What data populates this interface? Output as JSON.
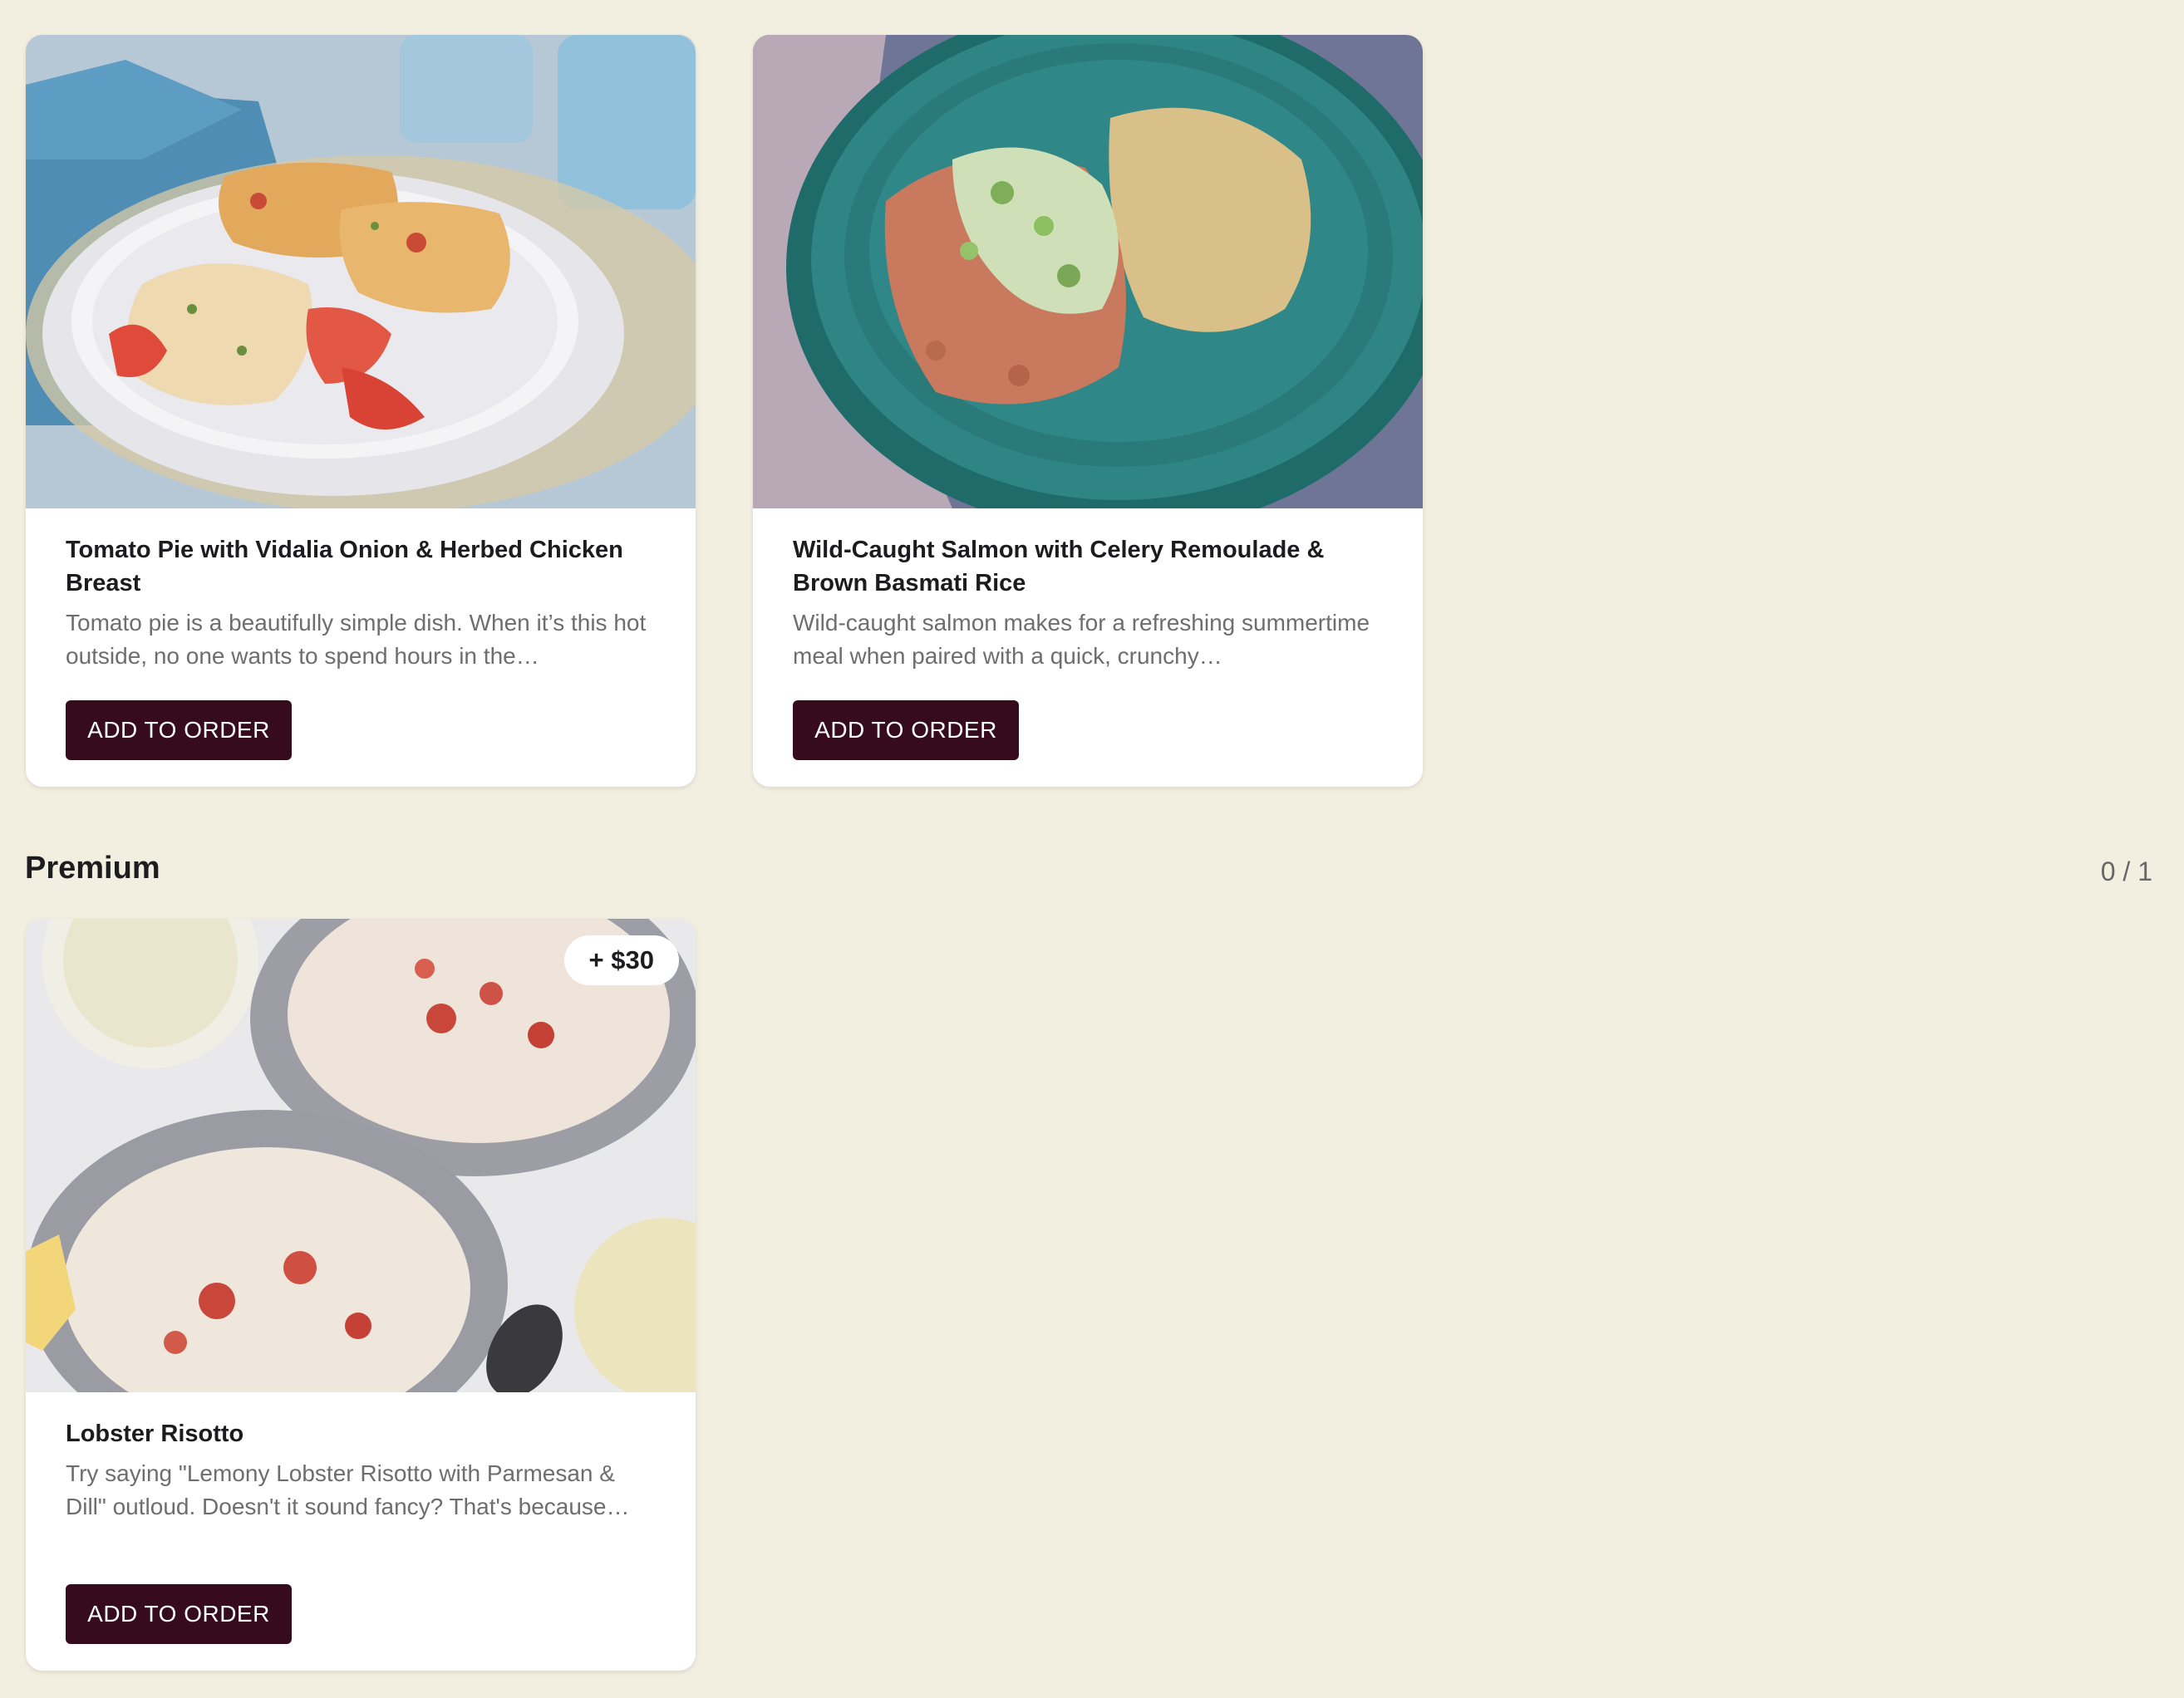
{
  "theme": {
    "background": "#f2efe0",
    "button_color": "#360c1c",
    "card_background": "#ffffff"
  },
  "meals": [
    {
      "title": "Tomato Pie with Vidalia Onion & Herbed Chicken Breast",
      "description": "Tomato pie is a beautifully simple dish. When it’s this hot outside, no one wants to spend hours in the…",
      "button_label": "ADD TO ORDER",
      "image": "tomato-pie-chicken-photo"
    },
    {
      "title": "Wild-Caught Salmon with Celery Remoulade & Brown Basmati Rice",
      "description": "Wild-caught salmon makes for a refreshing summertime meal when paired with a quick, crunchy…",
      "button_label": "ADD TO ORDER",
      "image": "salmon-rice-photo"
    }
  ],
  "premium": {
    "section_title": "Premium",
    "count": "0 / 1",
    "items": [
      {
        "title": "Lobster Risotto",
        "description": "Try saying \"Lemony Lobster Risotto with Parmesan & Dill\" outloud. Doesn't it sound fancy? That's because…",
        "button_label": "ADD TO ORDER",
        "price_badge": "+ $30",
        "image": "lobster-risotto-photo"
      }
    ]
  }
}
